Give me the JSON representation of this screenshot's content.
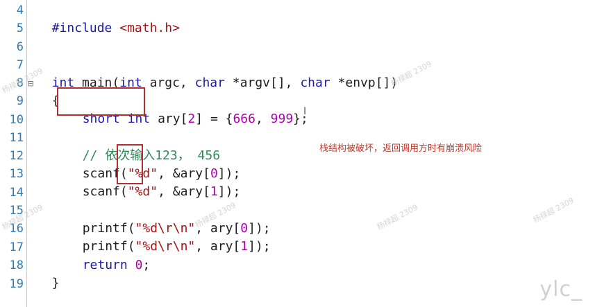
{
  "editor": {
    "line_numbers": [
      "4",
      "5",
      "6",
      "7",
      "8",
      "9",
      "10",
      "11",
      "12",
      "13",
      "14",
      "15",
      "16",
      "17",
      "18",
      "19"
    ],
    "lines": {
      "l4": {
        "directive": "#include",
        "header": "<math.h>"
      },
      "l7": {
        "t1": "int",
        "t2": " main(",
        "t3": "int",
        "t4": " argc, ",
        "t5": "char",
        "t6": " *argv[], ",
        "t7": "char",
        "t8": " *envp[])"
      },
      "l8": {
        "t1": "{"
      },
      "l9": {
        "t1": "short",
        "t2": " ",
        "t3": "int",
        "t4": " ary[",
        "t5": "2",
        "t6": "] = {",
        "t7": "666",
        "t8": ", ",
        "t9": "999",
        "t10": "};"
      },
      "l11": {
        "comment": "// 依次输入123， 456"
      },
      "l12": {
        "t1": "scanf(",
        "t2": "\"%d\"",
        "t3": ", &ary[",
        "t4": "0",
        "t5": "]);"
      },
      "l13": {
        "t1": "scanf(",
        "t2": "\"%d\"",
        "t3": ", &ary[",
        "t4": "1",
        "t5": "]);"
      },
      "l15": {
        "t1": "printf(",
        "t2": "\"%d\\r\\n\"",
        "t3": ", ary[",
        "t4": "0",
        "t5": "]);"
      },
      "l16": {
        "t1": "printf(",
        "t2": "\"%d\\r\\n\"",
        "t3": ", ary[",
        "t4": "1",
        "t5": "]);"
      },
      "l17": {
        "t1": "return",
        "t2": " ",
        "t3": "0",
        "t4": ";"
      },
      "l18": {
        "t1": "}"
      }
    },
    "fold_marker": "⊟",
    "text_cursor": "I"
  },
  "annotation": {
    "note": "栈结构被破坏，返回调用方时有崩溃风险"
  },
  "watermark": {
    "text": "杨禄超 2309"
  },
  "logo": "ylc_",
  "colors": {
    "keyword": "#1a1aa6",
    "string": "#a31515",
    "number": "#b000b0",
    "comment": "#2e8b57",
    "line_number": "#2b7bb9",
    "highlight_box": "#b03030",
    "note": "#c0392b"
  }
}
